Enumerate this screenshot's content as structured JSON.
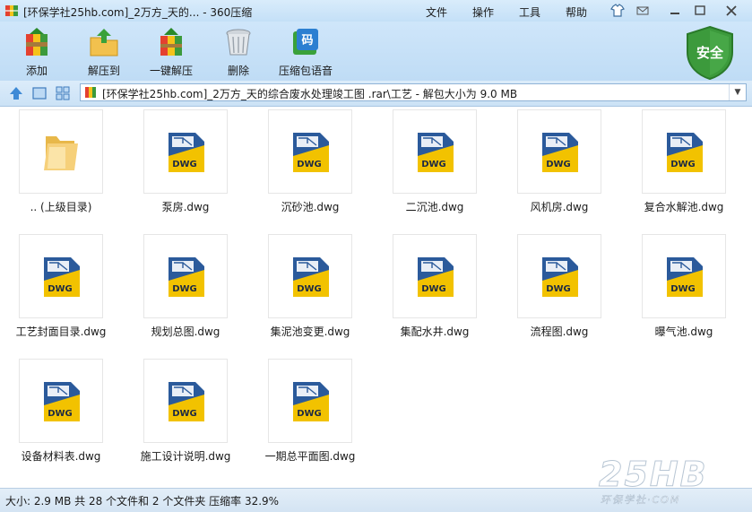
{
  "window": {
    "title": "[环保学社25hb.com]_2万方_天的... - 360压缩",
    "menu": [
      "文件",
      "操作",
      "工具",
      "帮助"
    ]
  },
  "toolbar": {
    "buttons": [
      {
        "label": "添加",
        "icon": "add-archive-icon"
      },
      {
        "label": "解压到",
        "icon": "extract-to-icon"
      },
      {
        "label": "一键解压",
        "icon": "one-click-extract-icon"
      },
      {
        "label": "删除",
        "icon": "delete-trash-icon"
      },
      {
        "label": "压缩包语音",
        "icon": "archive-voice-icon"
      }
    ],
    "security_label": "安全"
  },
  "address": {
    "path": "[环保学社25hb.com]_2万方_天的综合废水处理竣工图 .rar\\工艺 - 解包大小为 9.0 MB"
  },
  "files": [
    {
      "name": ".. (上级目录)",
      "type": "folder"
    },
    {
      "name": "泵房.dwg",
      "type": "dwg"
    },
    {
      "name": "沉砂池.dwg",
      "type": "dwg"
    },
    {
      "name": "二沉池.dwg",
      "type": "dwg"
    },
    {
      "name": "风机房.dwg",
      "type": "dwg"
    },
    {
      "name": "复合水解池.dwg",
      "type": "dwg"
    },
    {
      "name": "工艺封面目录.dwg",
      "type": "dwg"
    },
    {
      "name": "规划总图.dwg",
      "type": "dwg"
    },
    {
      "name": "集泥池变更.dwg",
      "type": "dwg"
    },
    {
      "name": "集配水井.dwg",
      "type": "dwg"
    },
    {
      "name": "流程图.dwg",
      "type": "dwg"
    },
    {
      "name": "曝气池.dwg",
      "type": "dwg"
    },
    {
      "name": "设备材料表.dwg",
      "type": "dwg"
    },
    {
      "name": "施工设计说明.dwg",
      "type": "dwg"
    },
    {
      "name": "一期总平面图.dwg",
      "type": "dwg"
    }
  ],
  "dwg_badge": "DWG",
  "status": {
    "text": "大小: 2.9 MB 共 28 个文件和 2 个文件夹 压缩率 32.9%"
  },
  "watermark": {
    "logo": "25HB",
    "tagline": "环保学社·COM"
  },
  "colors": {
    "titlebar": "#d9ecfb",
    "toolbar": "#c4def5",
    "shield_green": "#3c9a3c",
    "dwg_yellow": "#f2c200",
    "dwg_blue": "#2b5a9b"
  }
}
